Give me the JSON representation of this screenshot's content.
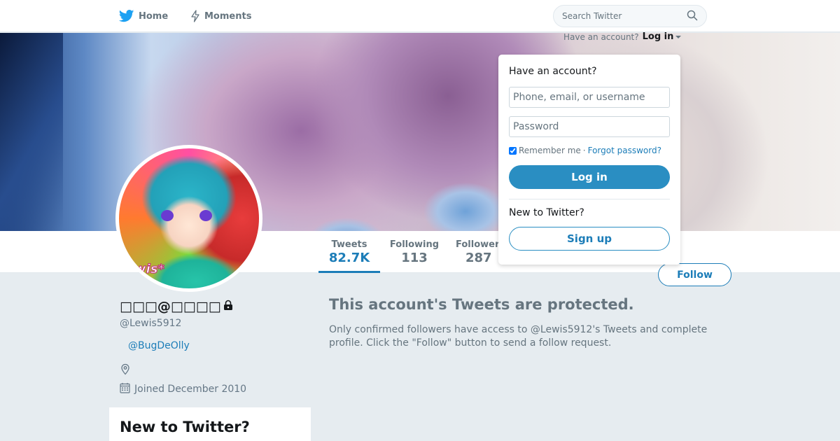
{
  "nav": {
    "home_label": "Home",
    "moments_label": "Moments",
    "search_placeholder": "Search Twitter"
  },
  "login_prompt": {
    "question": "Have an account?",
    "toggle_label": "Log in"
  },
  "dropdown": {
    "title": "Have an account?",
    "phone_placeholder": "Phone, email, or username",
    "password_placeholder": "Password",
    "remember_label": "Remember me",
    "separator": "·",
    "forgot_label": "Forgot password?",
    "login_button": "Log in",
    "new_label": "New to Twitter?",
    "signup_button": "Sign up"
  },
  "stats": [
    {
      "label": "Tweets",
      "value": "82.7K",
      "active": true
    },
    {
      "label": "Following",
      "value": "113",
      "active": false
    },
    {
      "label": "Followers",
      "value": "287",
      "active": false
    }
  ],
  "follow_button": "Follow",
  "profile": {
    "name": "□□□@□□□□",
    "handle": "@Lewis5912",
    "link": "@BugDeOlly",
    "joined": "Joined December 2010",
    "avatar_text": "wis*"
  },
  "new_card_title": "New to Twitter?",
  "protected": {
    "title": "This account's Tweets are protected.",
    "body": "Only confirmed followers have access to @Lewis5912's Tweets and complete profile. Click the \"Follow\" button to send a follow request."
  },
  "colors": {
    "accent": "#1c7db8",
    "button_fill": "#2a8ec2",
    "background": "#e6ecf0"
  }
}
